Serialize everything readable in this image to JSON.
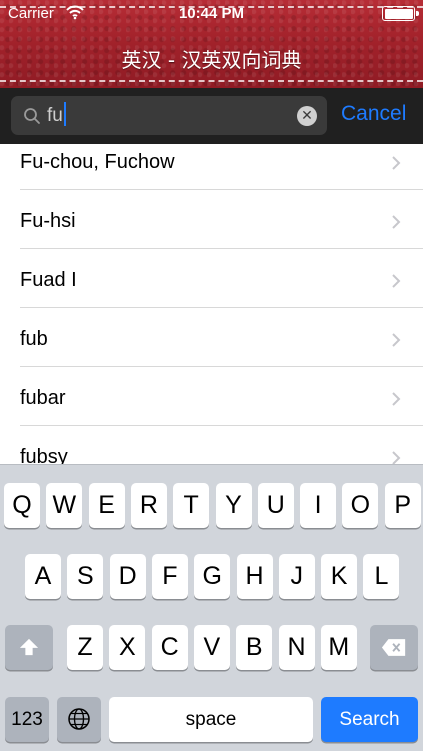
{
  "status": {
    "carrier": "Carrier",
    "time": "10:44 PM"
  },
  "header": {
    "title": "英汉 - 汉英双向词典"
  },
  "search": {
    "value": "fu",
    "cancel_label": "Cancel"
  },
  "results": [
    {
      "label": "Fu-chou, Fuchow"
    },
    {
      "label": "Fu-hsi"
    },
    {
      "label": "Fuad I"
    },
    {
      "label": "fub"
    },
    {
      "label": "fubar"
    },
    {
      "label": "fubsy"
    }
  ],
  "keyboard": {
    "row1": [
      "Q",
      "W",
      "E",
      "R",
      "T",
      "Y",
      "U",
      "I",
      "O",
      "P"
    ],
    "row2": [
      "A",
      "S",
      "D",
      "F",
      "G",
      "H",
      "J",
      "K",
      "L"
    ],
    "row3": [
      "Z",
      "X",
      "C",
      "V",
      "B",
      "N",
      "M"
    ],
    "numbers_label": "123",
    "space_label": "space",
    "search_label": "Search"
  },
  "colors": {
    "header_red": "#a3222b",
    "accent_blue": "#1e7bff",
    "searchbar_bg": "#202020",
    "keyboard_bg": "#d1d5db"
  }
}
